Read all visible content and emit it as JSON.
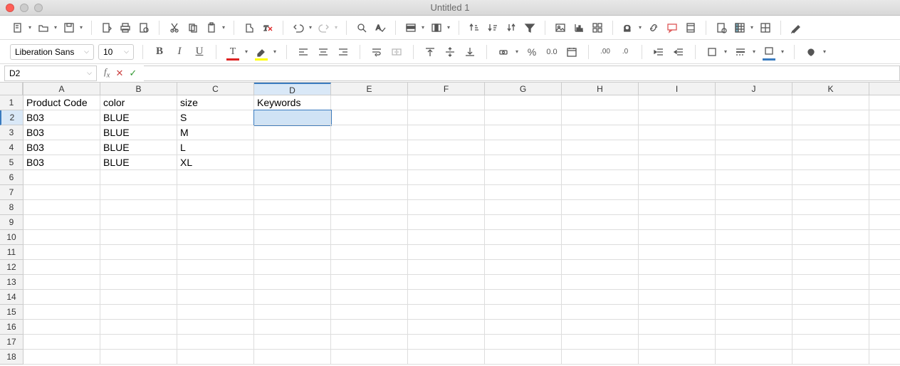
{
  "window": {
    "title": "Untitled 1"
  },
  "font": {
    "name": "Liberation Sans",
    "size": "10"
  },
  "namebox": {
    "ref": "D2"
  },
  "formula": {
    "value": ""
  },
  "columns": [
    "A",
    "B",
    "C",
    "D",
    "E",
    "F",
    "G",
    "H",
    "I",
    "J",
    "K"
  ],
  "rows": [
    "1",
    "2",
    "3",
    "4",
    "5",
    "6",
    "7",
    "8",
    "9",
    "10",
    "11",
    "12",
    "13",
    "14",
    "15",
    "16",
    "17",
    "18"
  ],
  "active_cell": {
    "row": 2,
    "col": "D"
  },
  "sheet": {
    "headers": [
      "Product Code",
      "color",
      "size",
      "Keywords"
    ],
    "data": [
      {
        "A": "B03",
        "B": "BLUE",
        "C": "S",
        "D": ""
      },
      {
        "A": "B03",
        "B": "BLUE",
        "C": "M",
        "D": ""
      },
      {
        "A": "B03",
        "B": "BLUE",
        "C": "L",
        "D": ""
      },
      {
        "A": "B03",
        "B": "BLUE",
        "C": "XL",
        "D": ""
      }
    ]
  },
  "colors": {
    "font_underline": "#d22",
    "highlight_underline": "#ff0",
    "frame_underline": "#3a7bbf"
  }
}
